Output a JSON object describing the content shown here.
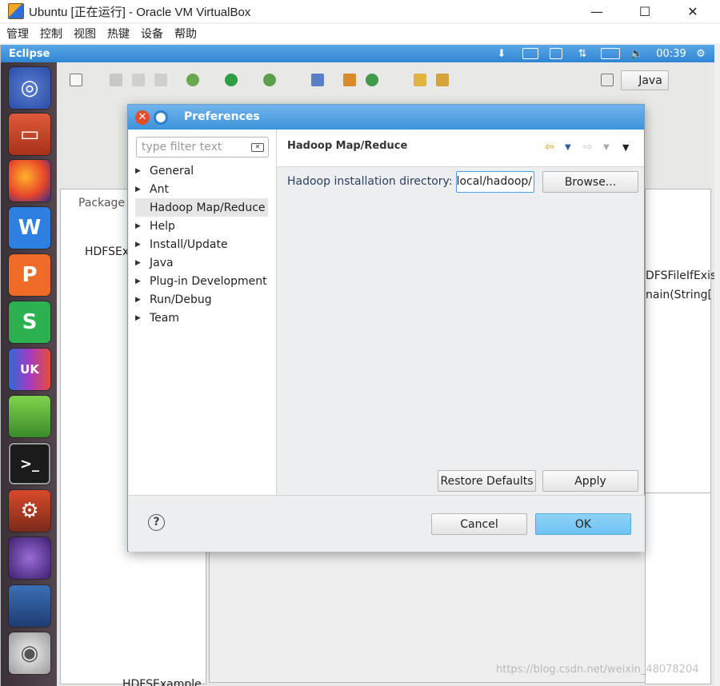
{
  "window": {
    "title": "Ubuntu [正在运行] - Oracle VM VirtualBox",
    "min": "—",
    "max": "☐",
    "close": "✕",
    "menu": [
      "管理",
      "控制",
      "视图",
      "热键",
      "设备",
      "帮助"
    ]
  },
  "topbar": {
    "label": "Eclipse",
    "time": "00:39"
  },
  "workbench": {
    "perspective_label": "Java",
    "package_tab": "Package",
    "project_item": "HDFSEx",
    "outline_line1": "DFSFileIfExis",
    "outline_line2": "nain(String[",
    "bottom_item": "HDFSExample"
  },
  "dialog": {
    "title": "Preferences",
    "filter_placeholder": "type filter text",
    "tree_items": [
      {
        "label": "General",
        "expandable": true
      },
      {
        "label": "Ant",
        "expandable": true
      },
      {
        "label": "Hadoop Map/Reduce",
        "expandable": false,
        "selected": true
      },
      {
        "label": "Help",
        "expandable": true
      },
      {
        "label": "Install/Update",
        "expandable": true
      },
      {
        "label": "Java",
        "expandable": true
      },
      {
        "label": "Plug-in Development",
        "expandable": true
      },
      {
        "label": "Run/Debug",
        "expandable": true
      },
      {
        "label": "Team",
        "expandable": true
      }
    ],
    "page_title": "Hadoop Map/Reduce",
    "field_label": "Hadoop installation directory:",
    "field_value": "/usr/local/hadoop",
    "browse_label": "Browse...",
    "restore_label": "Restore Defaults",
    "apply_label": "Apply",
    "cancel_label": "Cancel",
    "ok_label": "OK"
  },
  "watermark": "https://blog.csdn.net/weixin_48078204",
  "colors": {
    "title_bar": "#3d93db",
    "ok_button": "#6ec3f3",
    "focus_border": "#4a9ee8"
  }
}
